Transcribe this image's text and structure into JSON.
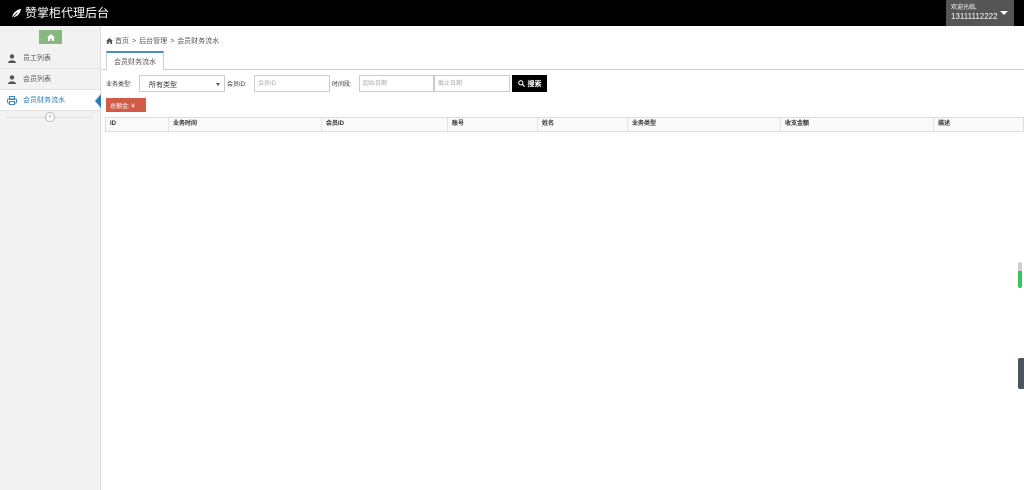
{
  "header": {
    "brand": "赞掌柜代理后台",
    "welcome": "欢迎光临,",
    "phone": "13111112222"
  },
  "sidebar": {
    "items": [
      {
        "label": "员工列表",
        "icon": "user-icon"
      },
      {
        "label": "会员列表",
        "icon": "user-icon"
      },
      {
        "label": "会员财务流水",
        "icon": "print-icon"
      }
    ],
    "active_index": 2
  },
  "breadcrumb": {
    "home": "首页",
    "sep": ">",
    "level1": "后台管理",
    "level2": "会员财务流水"
  },
  "tab": {
    "label": "会员财务流水"
  },
  "filters": {
    "type_label": "业务类型:",
    "type_value": "所有类型",
    "member_label": "会员ID:",
    "member_placeholder": "会员ID",
    "time_label": "时间段:",
    "start_placeholder": "起始日期",
    "end_placeholder": "截止日期",
    "search_label": "搜索"
  },
  "total": {
    "label": "总额金: ¥"
  },
  "table": {
    "columns": [
      "ID",
      "业务时间",
      "会员ID",
      "账号",
      "姓名",
      "业务类型",
      "收支金额",
      "描述"
    ]
  },
  "colors": {
    "topbar": "#000000",
    "accent_blue": "#2b7dbc",
    "home_green": "#87b87f",
    "badge_red": "#d15b47"
  }
}
